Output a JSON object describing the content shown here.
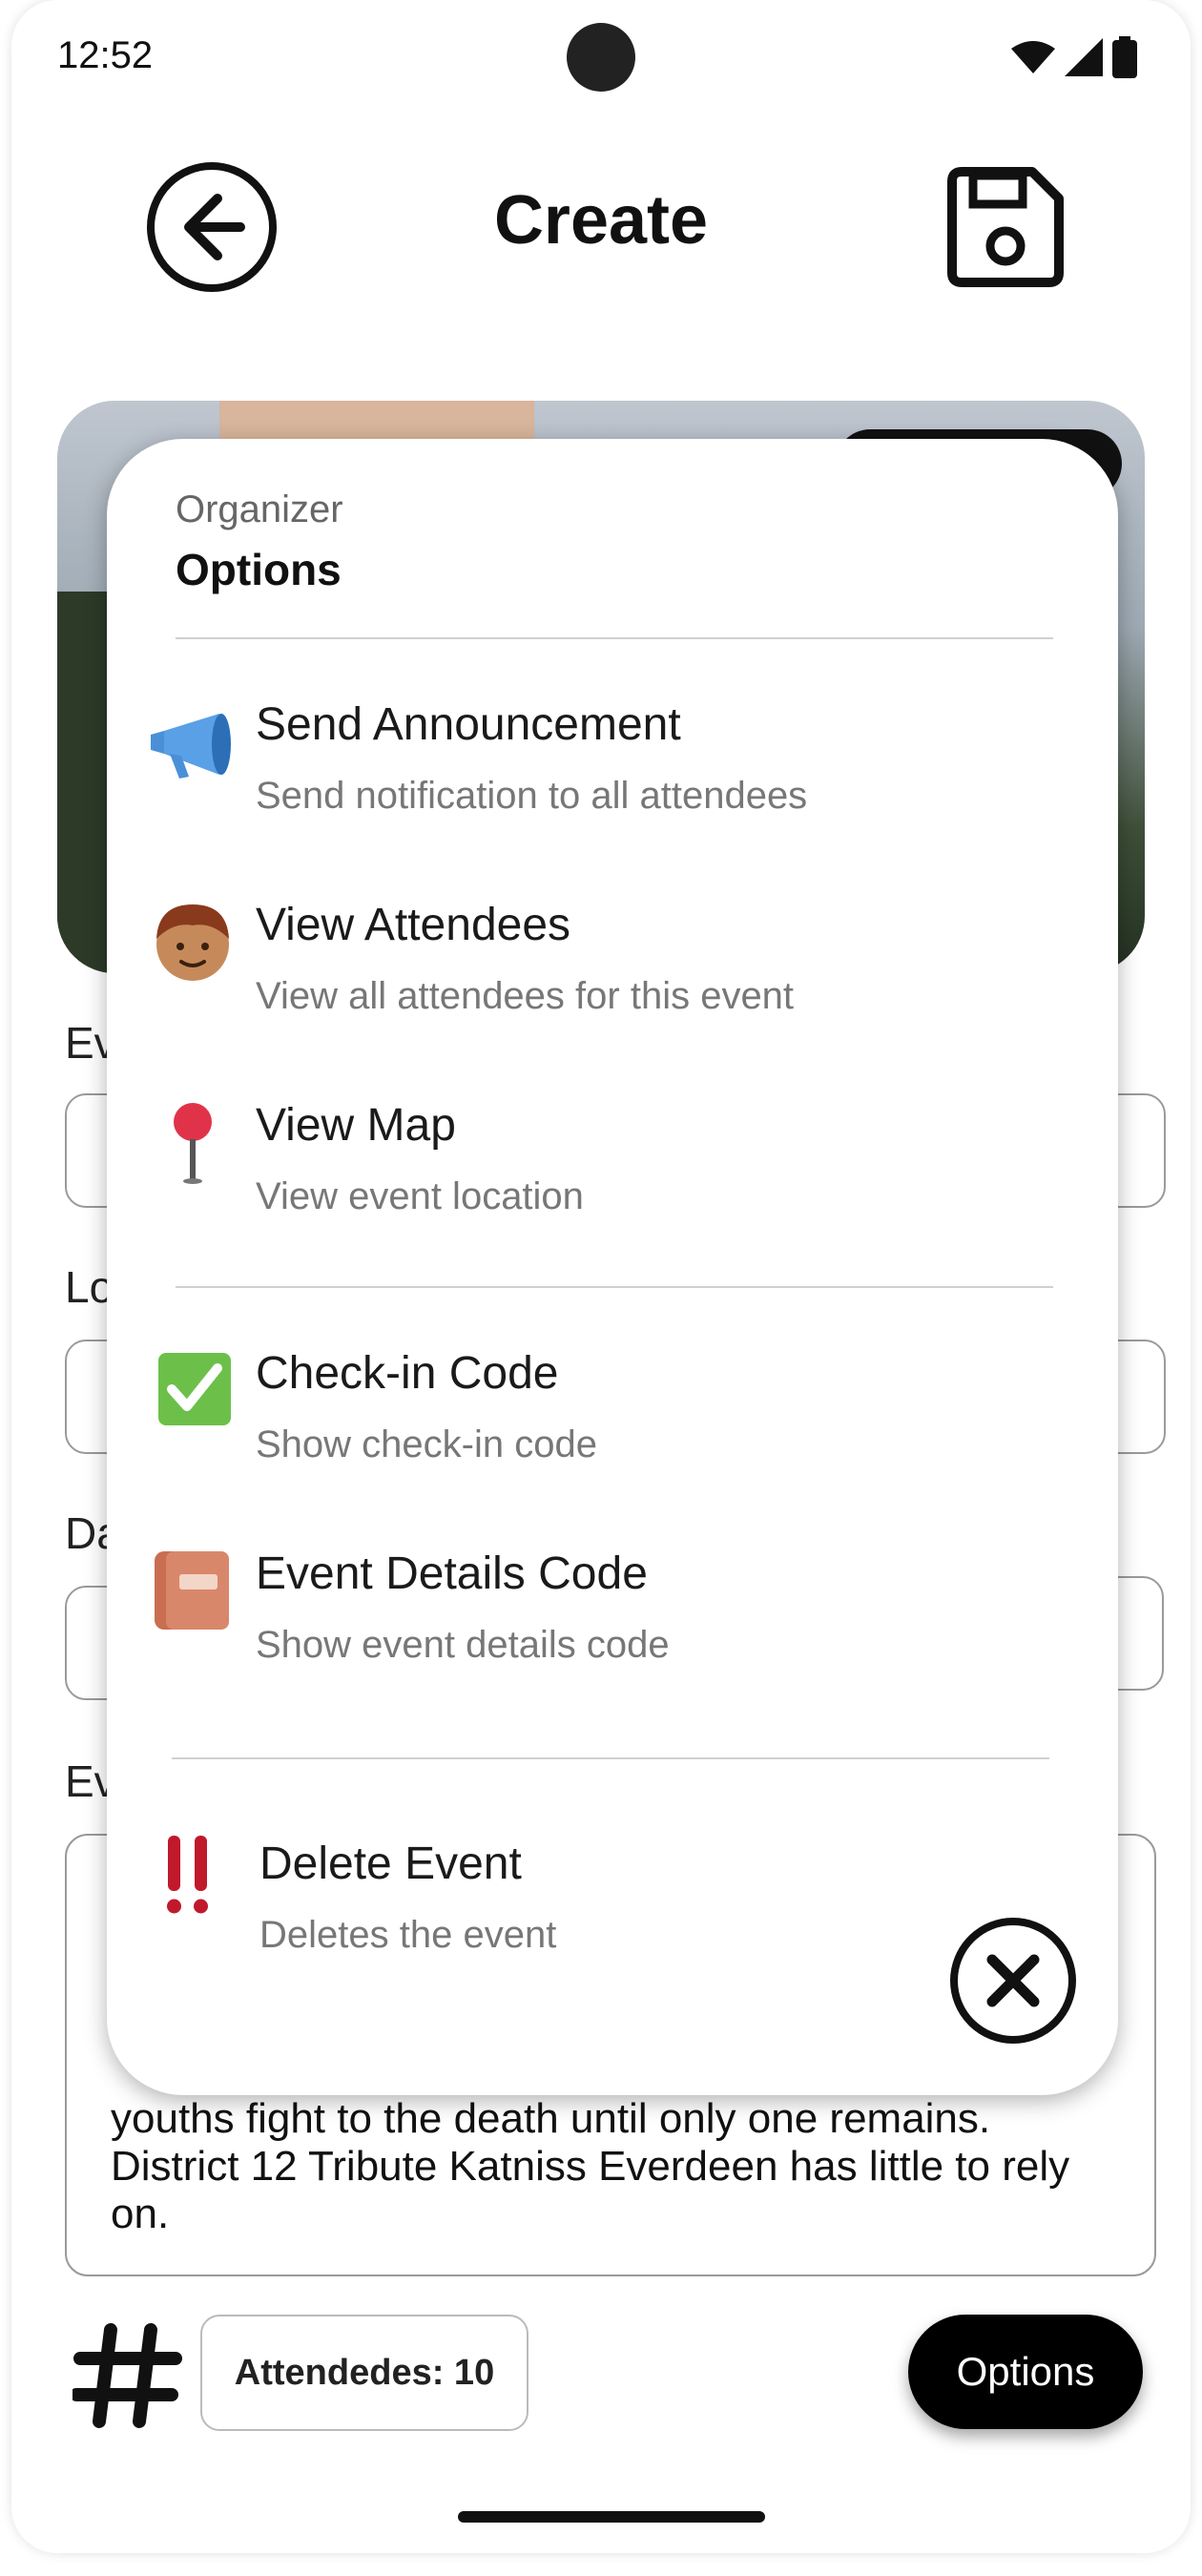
{
  "status": {
    "time": "12:52"
  },
  "header": {
    "title": "Create"
  },
  "form": {
    "labels": [
      "Ev",
      "Lo",
      "Da",
      "Ev"
    ],
    "description_text": "youths fight to the death until only one remains. District 12 Tribute Katniss Everdeen has little to rely on."
  },
  "bottom": {
    "attendees": "Attendedes: 10",
    "options_label": "Options"
  },
  "modal": {
    "subtitle": "Organizer",
    "title": "Options",
    "items": [
      {
        "icon": "megaphone-icon",
        "label": "Send Announcement",
        "desc": "Send notification to all attendees"
      },
      {
        "icon": "person-icon",
        "label": "View Attendees",
        "desc": "View all attendees for this event"
      },
      {
        "icon": "pushpin-icon",
        "label": "View Map",
        "desc": "View event location"
      },
      {
        "icon": "check-icon",
        "label": "Check-in Code",
        "desc": "Show check-in code"
      },
      {
        "icon": "book-icon",
        "label": "Event Details Code",
        "desc": "Show event details code"
      },
      {
        "icon": "exclamation-icon",
        "label": "Delete Event",
        "desc": "Deletes the event"
      }
    ]
  },
  "colors": {
    "accent_black": "#000000",
    "delete_red": "#c0192b",
    "check_green": "#6cc04a",
    "megaphone_blue": "#4a90d9"
  }
}
